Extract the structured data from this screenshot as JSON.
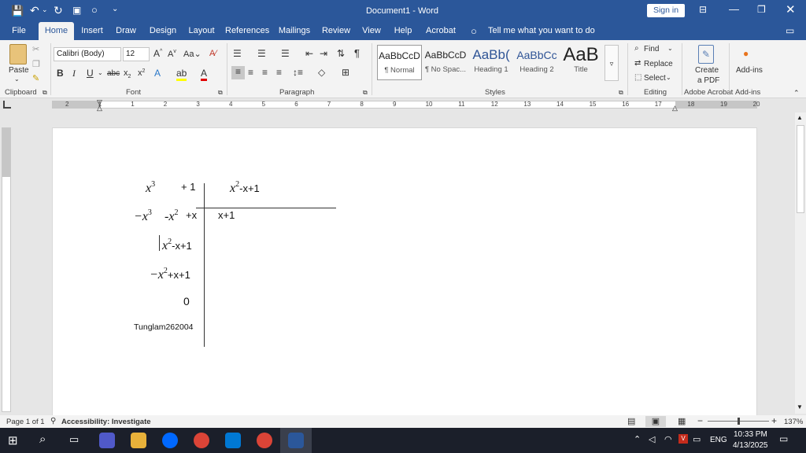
{
  "titlebar": {
    "title": "Document1 - Word",
    "signin": "Sign in"
  },
  "tabs": [
    "File",
    "Home",
    "Insert",
    "Draw",
    "Design",
    "Layout",
    "References",
    "Mailings",
    "Review",
    "View",
    "Help",
    "Acrobat"
  ],
  "tell_me": "Tell me what you want to do",
  "ribbon": {
    "clipboard": {
      "paste": "Paste",
      "label": "Clipboard"
    },
    "font": {
      "name": "Calibri (Body)",
      "size": "12",
      "label": "Font"
    },
    "paragraph": {
      "label": "Paragraph"
    },
    "styles": {
      "label": "Styles",
      "items": [
        {
          "preview": "AaBbCcD",
          "name": "¶ Normal"
        },
        {
          "preview": "AaBbCcD",
          "name": "¶ No Spac..."
        },
        {
          "preview": "AaBb(",
          "name": "Heading 1"
        },
        {
          "preview": "AaBbCc",
          "name": "Heading 2"
        },
        {
          "preview": "AaB",
          "name": "Title"
        }
      ]
    },
    "editing": {
      "find": "Find",
      "replace": "Replace",
      "select": "Select",
      "label": "Editing"
    },
    "acrobat": {
      "create": "Create",
      "pdf": "a PDF",
      "label": "Adobe Acrobat"
    },
    "addins": {
      "button": "Add-ins",
      "label": "Add-ins"
    }
  },
  "ruler_numbers": [
    "2",
    "1",
    "1",
    "2",
    "3",
    "4",
    "5",
    "6",
    "7",
    "8",
    "9",
    "10",
    "11",
    "12",
    "13",
    "14",
    "15",
    "16",
    "17",
    "18",
    "19",
    "20"
  ],
  "document": {
    "row1_dividend_x": "x",
    "row1_dividend_exp": "3",
    "row1_dividend_rest": "+ 1",
    "divisor_x": "x",
    "divisor_exp": "2",
    "divisor_rest": "-x+1",
    "row2_a": "−x",
    "row2_a_exp": "3",
    "row2_b": "-x",
    "row2_b_exp": "2",
    "row2_c": "+x",
    "quotient": "x+1",
    "row3_x": "x",
    "row3_exp": "2",
    "row3_rest": "-x+1",
    "row4_x": "−x",
    "row4_exp": "2",
    "row4_rest": "+x+1",
    "remainder": "0",
    "author": "Tunglam262004"
  },
  "status": {
    "page": "Page 1 of 1",
    "accessibility": "Accessibility: Investigate",
    "zoom": "137%"
  },
  "taskbar": {
    "time": "10:33 PM",
    "date": "4/13/2025",
    "lang": "ENG"
  },
  "colors": {
    "word_blue": "#2b579a",
    "taskbar": "#1b1f2a"
  }
}
